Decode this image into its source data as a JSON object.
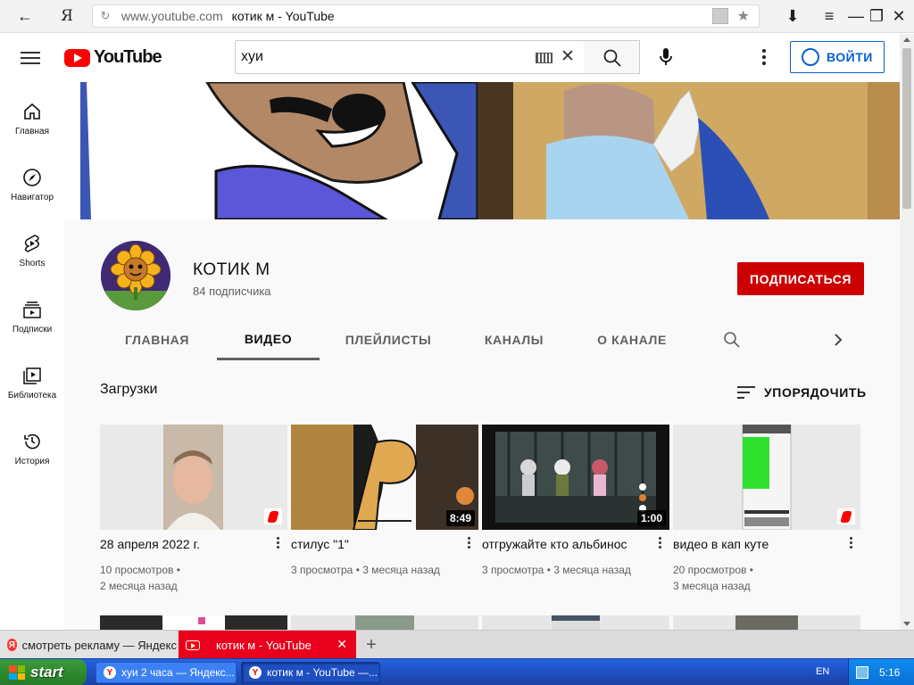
{
  "browser": {
    "brand_glyph": "Я",
    "url_domain": "www.youtube.com",
    "url_title": "котик м - YouTube",
    "back_glyph": "←",
    "menu_glyph": "≡",
    "min_glyph": "—",
    "max_glyph": "❐",
    "close_glyph": "✕",
    "download_glyph": "⬇",
    "star_glyph": "★",
    "reload_glyph": "↻"
  },
  "header": {
    "logo_text": "YouTube",
    "search_value": "хуи",
    "signin_label": "ВОЙТИ"
  },
  "sidebar": {
    "items": [
      {
        "label": "Главная",
        "icon": "home-icon"
      },
      {
        "label": "Навигатор",
        "icon": "compass-icon"
      },
      {
        "label": "Shorts",
        "icon": "shorts-icon"
      },
      {
        "label": "Подписки",
        "icon": "subscriptions-icon"
      },
      {
        "label": "Библиотека",
        "icon": "library-icon"
      },
      {
        "label": "История",
        "icon": "history-icon"
      }
    ]
  },
  "channel": {
    "name": "КОТИК М",
    "subscribers": "84 подписчика",
    "subscribe_label": "ПОДПИСАТЬСЯ",
    "tabs": [
      {
        "label": "ГЛАВНАЯ",
        "active": false
      },
      {
        "label": "ВИДЕО",
        "active": true
      },
      {
        "label": "ПЛЕЙЛИСТЫ",
        "active": false
      },
      {
        "label": "КАНАЛЫ",
        "active": false
      },
      {
        "label": "О КАНАЛЕ",
        "active": false
      }
    ]
  },
  "section": {
    "title": "Загрузки",
    "sort_label": "УПОРЯДОЧИТЬ"
  },
  "videos": [
    {
      "title": "28 апреля 2022 г.",
      "views": "10 просмотров •",
      "age": "2 месяца назад",
      "badge": "shorts"
    },
    {
      "title": "стилус \"1\"",
      "views": "3 просмотра • 3 месяца назад",
      "age": "",
      "badge": "8:49"
    },
    {
      "title": "отгружайте кто альбинос",
      "views": "3 просмотра • 3 месяца назад",
      "age": "",
      "badge": "1:00"
    },
    {
      "title": "видео в кап куте",
      "views": "20 просмотров •",
      "age": "3 месяца назад",
      "badge": "shorts"
    }
  ],
  "browser_tabs": [
    {
      "label": "смотреть рекламу — Яндекс",
      "active": false
    },
    {
      "label": "котик м - YouTube",
      "active": true,
      "close": "✕"
    }
  ],
  "new_tab_glyph": "+",
  "taskbar": {
    "start_label": "start",
    "tasks": [
      {
        "label": "хуи 2 часа — Яндекс..."
      },
      {
        "label": "котик м - YouTube —..."
      }
    ],
    "lang": "EN",
    "time": "5:16"
  },
  "colors": {
    "yt_red": "#ff0000",
    "subscribe_red": "#cc0000",
    "signin_blue": "#065fd4",
    "yandex_tab_red": "#e8001c",
    "xp_blue": "#245edb",
    "xp_start_green": "#2e8b2e"
  }
}
